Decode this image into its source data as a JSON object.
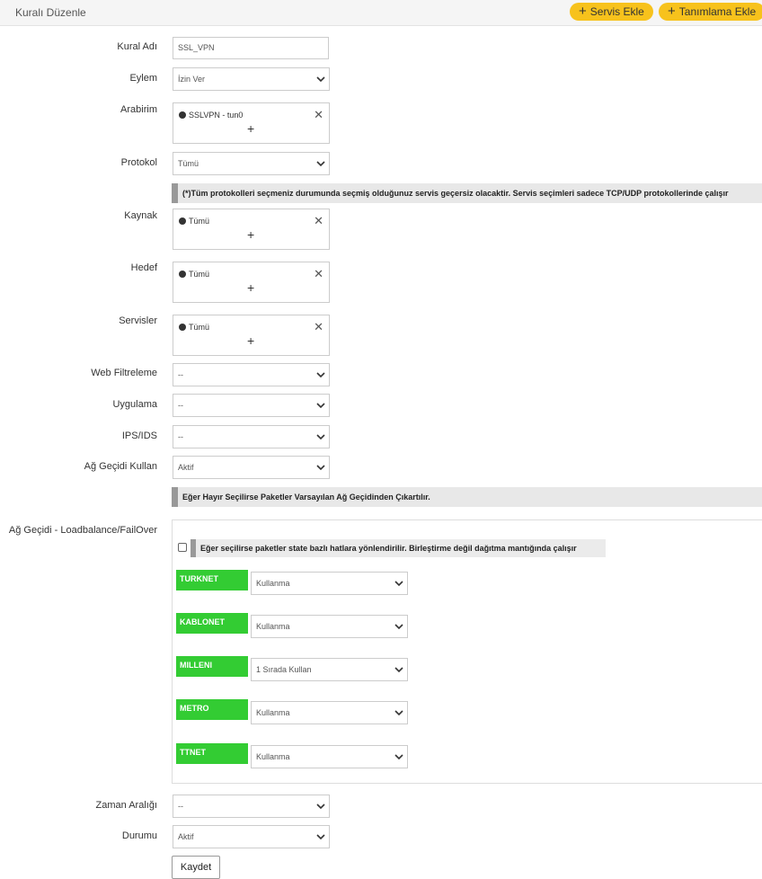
{
  "header": {
    "title": "Kuralı Düzenle",
    "add_service_label": "Servis Ekle",
    "add_definition_label": "Tanımlama Ekle"
  },
  "form": {
    "rule_name": {
      "label": "Kural Adı",
      "value": "SSL_VPN"
    },
    "action": {
      "label": "Eylem",
      "value": "İzin Ver"
    },
    "interface": {
      "label": "Arabirim",
      "tag": "SSLVPN - tun0"
    },
    "protocol": {
      "label": "Protokol",
      "value": "Tümü"
    },
    "protocol_note": "(*)Tüm protokolleri seçmeniz durumunda seçmiş olduğunuz servis geçersiz olacaktir. Servis seçimleri sadece TCP/UDP protokollerinde çalışır",
    "source": {
      "label": "Kaynak",
      "tag": "Tümü"
    },
    "destination": {
      "label": "Hedef",
      "tag": "Tümü"
    },
    "services": {
      "label": "Servisler",
      "tag": "Tümü"
    },
    "web_filter": {
      "label": "Web Filtreleme",
      "value": "--"
    },
    "application": {
      "label": "Uygulama",
      "value": "--"
    },
    "ips_ids": {
      "label": "IPS/IDS",
      "value": "--"
    },
    "gateway_use": {
      "label": "Ağ Geçidi Kullan",
      "value": "Aktif"
    },
    "gateway_note": "Eğer Hayır Seçilirse Paketler Varsayılan Ağ Geçidinden Çıkartılır.",
    "loadbalance": {
      "label": "Ağ Geçidi - Loadbalance/FailOver",
      "checkbox_note": "Eğer seçilirse paketler state bazlı hatlara yönlendirilir. Birleştirme değil dağıtma mantığında çalışır",
      "gateways": [
        {
          "name": "TURKNET",
          "value": "Kullanma"
        },
        {
          "name": "KABLONET",
          "value": "Kullanma"
        },
        {
          "name": "MILLENI",
          "value": "1 Sırada Kullan"
        },
        {
          "name": "METRO",
          "value": "Kullanma"
        },
        {
          "name": "TTNET",
          "value": "Kullanma"
        }
      ]
    },
    "time_range": {
      "label": "Zaman Aralığı",
      "value": "--"
    },
    "status": {
      "label": "Durumu",
      "value": "Aktif"
    },
    "save_label": "Kaydet"
  },
  "colors": {
    "accent": "#f7c21c",
    "gateway_green": "#33cc33"
  },
  "icons": {
    "plus": "plus-icon",
    "close": "close-icon",
    "chevron": "chevron-down-icon",
    "globe": "globe-icon"
  }
}
